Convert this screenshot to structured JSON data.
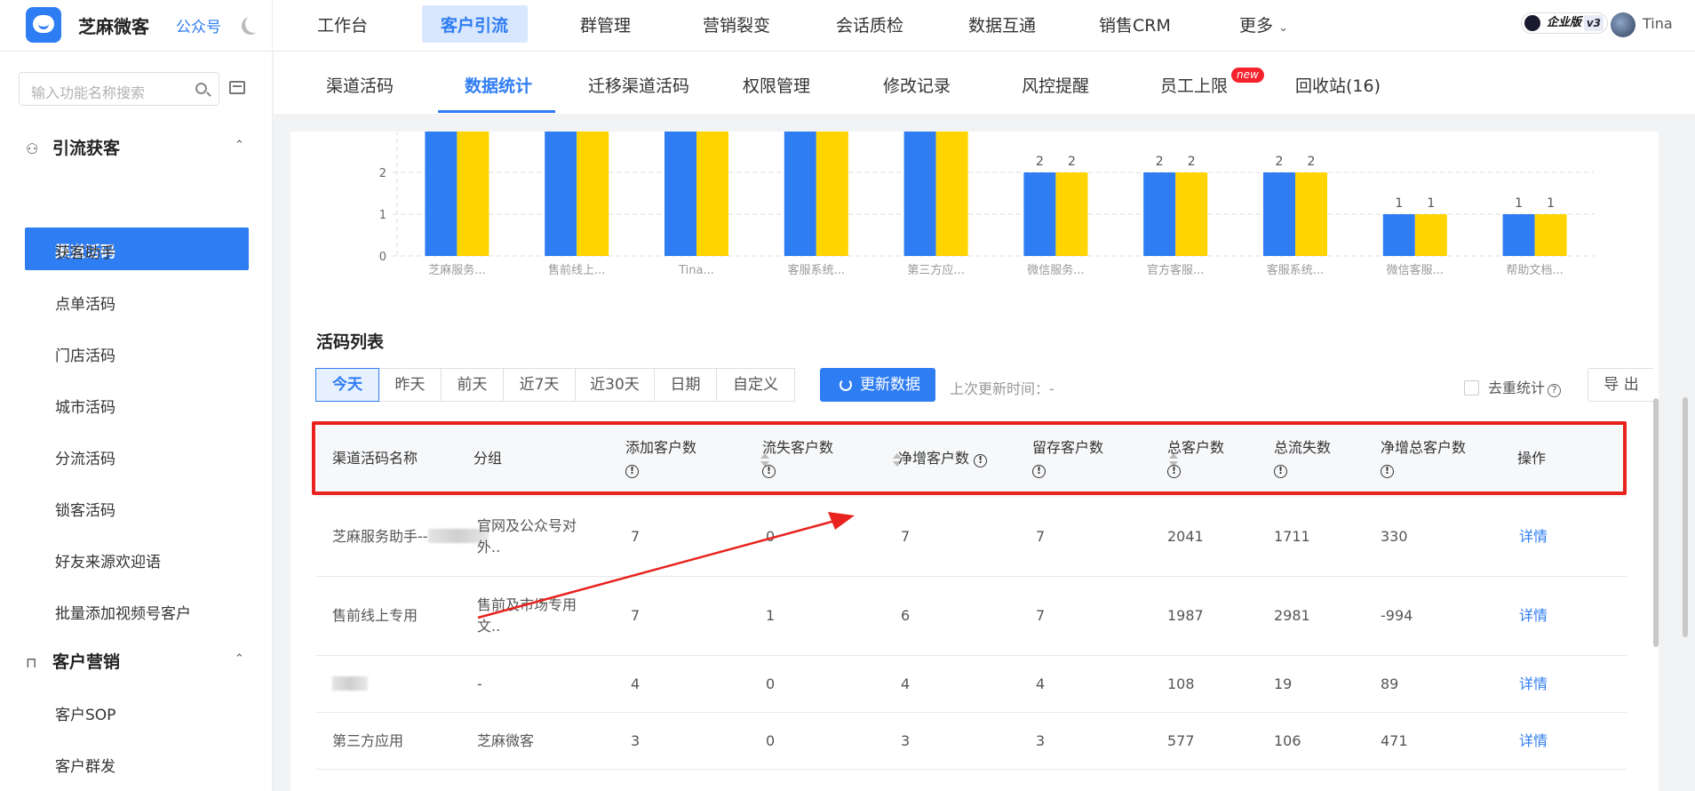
{
  "topbar": {
    "brand": "芝麻微客",
    "gzh": "公众号",
    "nav": [
      "工作台",
      "客户引流",
      "群管理",
      "营销裂变",
      "会话质检",
      "数据互通",
      "销售CRM",
      "更多"
    ],
    "nav_active": "客户引流",
    "edition": "企业版",
    "edition_version": "v3",
    "user": "Tina"
  },
  "sidebar": {
    "search_placeholder": "输入功能名称搜索",
    "section1": "引流获客",
    "section1_items": [
      "渠道活码",
      "获客助手",
      "点单活码",
      "门店活码",
      "城市活码",
      "分流活码",
      "锁客活码",
      "好友来源欢迎语",
      "批量添加视频号客户"
    ],
    "section2": "客户营销",
    "section2_items": [
      "客户SOP",
      "客户群发"
    ]
  },
  "subtabs": {
    "items": [
      "渠道活码",
      "数据统计",
      "迁移渠道活码",
      "权限管理",
      "修改记录",
      "风控提醒",
      "员工上限",
      "回收站(16)"
    ],
    "active": "数据统计",
    "new_badge": "new"
  },
  "chart_data": {
    "type": "bar",
    "categories": [
      "芝麻服务...",
      "售前线上...",
      "Tina...",
      "客服系统...",
      "第三方应...",
      "微信服务...",
      "官方客服...",
      "客服系统...",
      "微信客服...",
      "帮助文档..."
    ],
    "series": [
      {
        "color": "#2f7df2",
        "values": [
          3,
          3,
          3,
          3,
          3,
          2,
          2,
          2,
          1,
          1
        ]
      },
      {
        "color": "#ffd400",
        "values": [
          3,
          3,
          3,
          3,
          3,
          2,
          2,
          2,
          1,
          1
        ]
      }
    ],
    "data_labels": [
      "",
      "",
      "",
      "",
      "",
      "2",
      "2",
      "2",
      "1",
      "1"
    ],
    "y_ticks": [
      0,
      1,
      2
    ],
    "ylim": [
      0,
      3
    ],
    "grid": true
  },
  "list": {
    "title": "活码列表",
    "filters": [
      "今天",
      "昨天",
      "前天",
      "近7天",
      "近30天",
      "日期",
      "自定义"
    ],
    "filter_active": "今天",
    "update_label": "更新数据",
    "last_update": "上次更新时间：-",
    "dedup_label": "去重统计",
    "export_label": "导 出",
    "columns": [
      "渠道活码名称",
      "分组",
      "添加客户数",
      "流失客户数",
      "净增客户数",
      "留存客户数",
      "总客户数",
      "总流失数",
      "净增总客户数",
      "操作"
    ],
    "rows": [
      {
        "name": "芝麻服务助手--",
        "group_l1": "官网及公众号对",
        "group_l2": "外..",
        "add": "7",
        "lost": "0",
        "net": "7",
        "retain": "7",
        "total": "2041",
        "total_lost": "1711",
        "net_total": "330",
        "op": "详情"
      },
      {
        "name": "售前线上专用",
        "group_l1": "售前及市场专用",
        "group_l2": "文..",
        "add": "7",
        "lost": "1",
        "net": "6",
        "retain": "7",
        "total": "1987",
        "total_lost": "2981",
        "net_total": "-994",
        "op": "详情"
      },
      {
        "name": "",
        "group_l1": "-",
        "group_l2": "",
        "add": "4",
        "lost": "0",
        "net": "4",
        "retain": "4",
        "total": "108",
        "total_lost": "19",
        "net_total": "89",
        "op": "详情"
      },
      {
        "name": "第三方应用",
        "group_l1": "芝麻微客",
        "group_l2": "",
        "add": "3",
        "lost": "0",
        "net": "3",
        "retain": "3",
        "total": "577",
        "total_lost": "106",
        "net_total": "471",
        "op": "详情"
      }
    ]
  },
  "annotation_color": "#e8231f"
}
